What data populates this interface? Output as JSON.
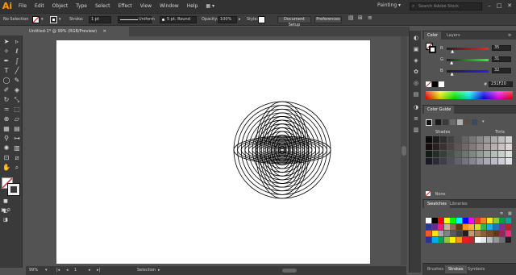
{
  "app": {
    "logo": "Ai",
    "workspace": "Painting ▾",
    "search_placeholder": "Search Adobe Stock"
  },
  "menu": [
    "File",
    "Edit",
    "Object",
    "Type",
    "Select",
    "Effect",
    "View",
    "Window",
    "Help"
  ],
  "window_buttons": [
    "–",
    "□",
    "✕"
  ],
  "control_bar": {
    "selection": "No Selection",
    "stroke_label": "Stroke:",
    "stroke_value": "1 pt",
    "profile": "Uniform",
    "brush": "5 pt. Round",
    "opacity_label": "Opacity:",
    "opacity_value": "100%",
    "style_label": "Style:",
    "doc_setup": "Document Setup",
    "preferences": "Preferences"
  },
  "document": {
    "tab_title": "Untitled-1* @ 99% (RGB/Preview)",
    "close": "✕"
  },
  "artwork": {
    "rings": 13,
    "stroke_color": "#000000",
    "background": "#ffffff"
  },
  "status": {
    "zoom": "99%",
    "page": "1",
    "tool": "Selection"
  },
  "color_panel": {
    "tabs": [
      "Color",
      "Layers"
    ],
    "channels": [
      {
        "label": "R",
        "value": "35",
        "color": "#e03030",
        "pos": 0.14
      },
      {
        "label": "G",
        "value": "31",
        "color": "#30c030",
        "pos": 0.12
      },
      {
        "label": "B",
        "value": "32",
        "color": "#3060e0",
        "pos": 0.13
      }
    ],
    "hex_prefix": "#",
    "hex": "231F20"
  },
  "color_guide": {
    "tab": "Color Guide",
    "shades": "Shades",
    "tints": "Tints"
  },
  "swatches": {
    "tabs": [
      "Swatches",
      "Libraries"
    ],
    "none_label": "None"
  },
  "bottom_tabs": [
    "Brushes",
    "Strokes",
    "Symbols"
  ],
  "accent": "#ff9a00"
}
